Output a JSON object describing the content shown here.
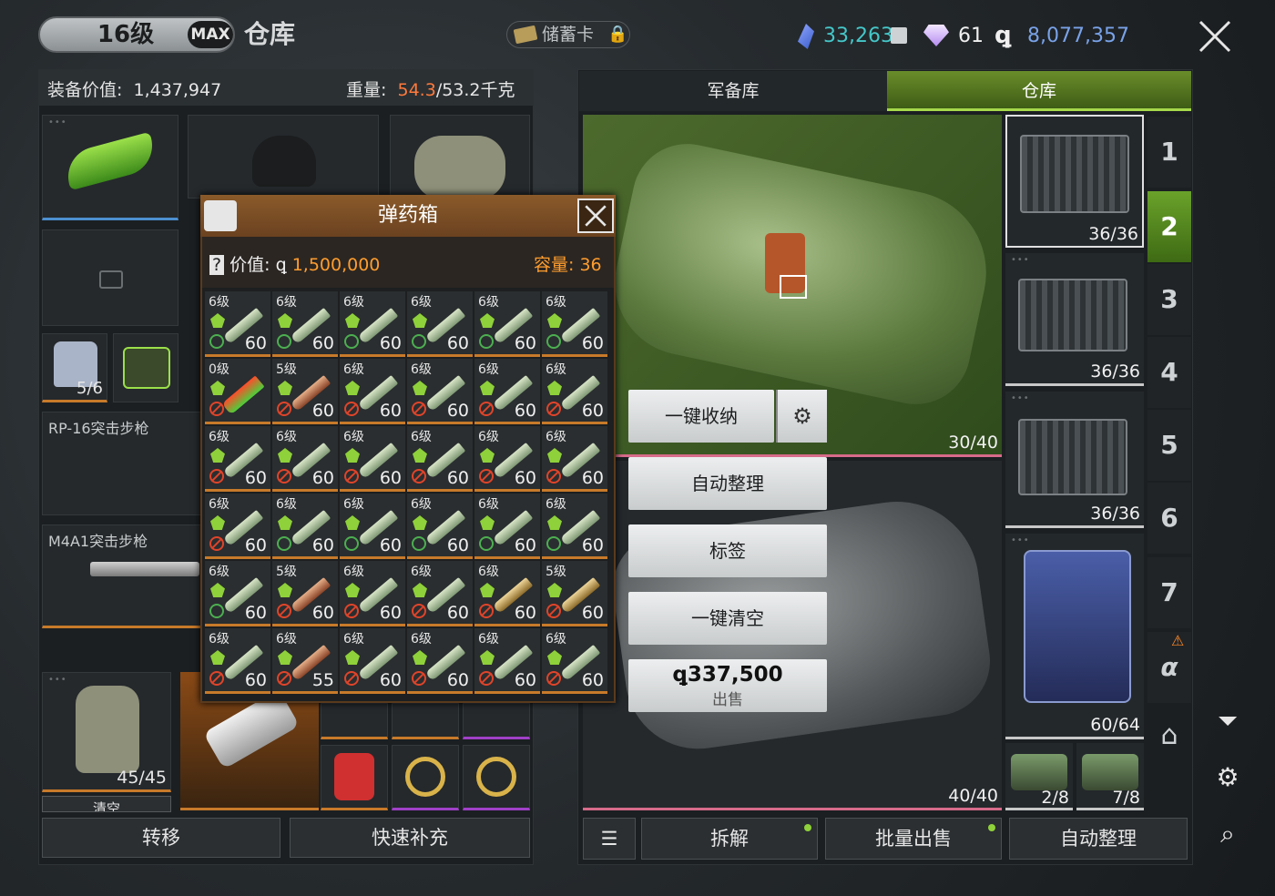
{
  "header": {
    "level": "16级",
    "max_badge": "MAX",
    "title": "仓库",
    "storage_card": "储蓄卡",
    "crystal": "33,263",
    "gems": "61",
    "coins": "8,077,357"
  },
  "left": {
    "equip_label": "装备价值:",
    "equip_value": "1,437,947",
    "weight_label": "重量:",
    "weight_current": "54.3",
    "weight_max": "/53.2千克",
    "armor_plate_count": "5/6",
    "gun1": "RP-16突击步枪",
    "gun2": "M4A1突击步枪",
    "backpack_count": "45/45",
    "clear_label": "清空",
    "transfer": "转移",
    "quick_refill": "快速补充"
  },
  "popup": {
    "title": "弹药箱",
    "value_label": "价值:",
    "value": "1,500,000",
    "capacity": "容量: 36",
    "cells": [
      {
        "level": "6级",
        "count": "60",
        "kind": "green",
        "ok": true
      },
      {
        "level": "6级",
        "count": "60",
        "kind": "green",
        "ok": true
      },
      {
        "level": "6级",
        "count": "60",
        "kind": "green",
        "ok": true
      },
      {
        "level": "6级",
        "count": "60",
        "kind": "green",
        "ok": true
      },
      {
        "level": "6级",
        "count": "60",
        "kind": "green",
        "ok": true
      },
      {
        "level": "6级",
        "count": "60",
        "kind": "green",
        "ok": true
      },
      {
        "level": "0级",
        "count": "",
        "kind": "rocket",
        "ok": false
      },
      {
        "level": "5级",
        "count": "60",
        "kind": "red",
        "ok": false
      },
      {
        "level": "6级",
        "count": "60",
        "kind": "silver",
        "ok": false
      },
      {
        "level": "6级",
        "count": "60",
        "kind": "silver",
        "ok": false
      },
      {
        "level": "6级",
        "count": "60",
        "kind": "silver",
        "ok": false
      },
      {
        "level": "6级",
        "count": "60",
        "kind": "silver",
        "ok": false
      },
      {
        "level": "6级",
        "count": "60",
        "kind": "silver",
        "ok": false
      },
      {
        "level": "6级",
        "count": "60",
        "kind": "silver",
        "ok": false
      },
      {
        "level": "6级",
        "count": "60",
        "kind": "silver",
        "ok": false
      },
      {
        "level": "6级",
        "count": "60",
        "kind": "silver",
        "ok": false
      },
      {
        "level": "6级",
        "count": "60",
        "kind": "silver",
        "ok": false
      },
      {
        "level": "6级",
        "count": "60",
        "kind": "silver",
        "ok": false
      },
      {
        "level": "6级",
        "count": "60",
        "kind": "green",
        "ok": false
      },
      {
        "level": "6级",
        "count": "60",
        "kind": "green",
        "ok": true
      },
      {
        "level": "6级",
        "count": "60",
        "kind": "green",
        "ok": true
      },
      {
        "level": "6级",
        "count": "60",
        "kind": "green",
        "ok": true
      },
      {
        "level": "6级",
        "count": "60",
        "kind": "green",
        "ok": true
      },
      {
        "level": "6级",
        "count": "60",
        "kind": "green",
        "ok": true
      },
      {
        "level": "6级",
        "count": "60",
        "kind": "green",
        "ok": true
      },
      {
        "level": "5级",
        "count": "60",
        "kind": "red",
        "ok": false
      },
      {
        "level": "6级",
        "count": "60",
        "kind": "silver",
        "ok": false
      },
      {
        "level": "6级",
        "count": "60",
        "kind": "silver",
        "ok": false
      },
      {
        "level": "6级",
        "count": "60",
        "kind": "gold",
        "ok": false
      },
      {
        "level": "5级",
        "count": "60",
        "kind": "gold",
        "ok": false
      },
      {
        "level": "6级",
        "count": "60",
        "kind": "silver",
        "ok": false
      },
      {
        "level": "6级",
        "count": "55",
        "kind": "red",
        "ok": false
      },
      {
        "level": "6级",
        "count": "60",
        "kind": "silver",
        "ok": false
      },
      {
        "level": "6级",
        "count": "60",
        "kind": "silver",
        "ok": false
      },
      {
        "level": "6级",
        "count": "60",
        "kind": "silver",
        "ok": false
      },
      {
        "level": "6级",
        "count": "60",
        "kind": "silver",
        "ok": false
      }
    ]
  },
  "right": {
    "tab_armory": "军备库",
    "tab_warehouse": "仓库",
    "bag1_count": "30/40",
    "bag2_count": "40/40",
    "btn_store_all": "一键收纳",
    "btn_auto_sort": "自动整理",
    "btn_tag": "标签",
    "btn_clear_all": "一键清空",
    "sell_price": "337,500",
    "sell_label": "出售",
    "cases": [
      "36/36",
      "36/36",
      "36/36",
      "60/64"
    ],
    "small_cases": [
      "2/8",
      "7/8"
    ],
    "pages": [
      "1",
      "2",
      "3",
      "4",
      "5",
      "6",
      "7",
      "α"
    ],
    "bottom_dismantle": "拆解",
    "bottom_bulk_sell": "批量出售",
    "bottom_auto_sort": "自动整理"
  }
}
